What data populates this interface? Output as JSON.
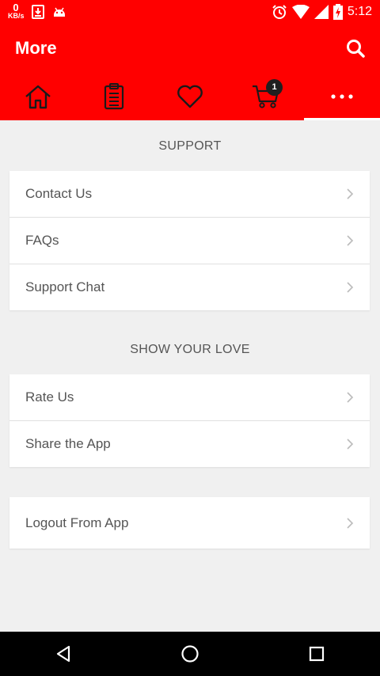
{
  "status_bar": {
    "speed_value": "0",
    "speed_unit": "KB/s",
    "time": "5:12",
    "icons": [
      "download-icon",
      "android-icon",
      "alarm-icon",
      "wifi-icon",
      "signal-icon",
      "battery-charging-icon"
    ]
  },
  "header": {
    "title": "More",
    "search_icon": "search-icon"
  },
  "tabs": [
    {
      "name": "home",
      "icon": "home-icon",
      "active": false
    },
    {
      "name": "orders",
      "icon": "clipboard-icon",
      "active": false
    },
    {
      "name": "wishlist",
      "icon": "heart-icon",
      "active": false
    },
    {
      "name": "cart",
      "icon": "cart-icon",
      "badge": "1",
      "active": false
    },
    {
      "name": "more",
      "icon": "more-dots-icon",
      "active": true
    }
  ],
  "sections": {
    "support": {
      "heading": "SUPPORT",
      "items": [
        "Contact Us",
        "FAQs",
        "Support Chat"
      ]
    },
    "show_love": {
      "heading": "SHOW YOUR LOVE",
      "items": [
        "Rate Us",
        "Share the App"
      ]
    },
    "account": {
      "items": [
        "Logout From App"
      ]
    }
  },
  "colors": {
    "brand_red": "#ff0000",
    "background": "#f0f0f0",
    "text_gray": "#555555",
    "divider": "#e0e0e0"
  },
  "nav_bar": {
    "icons": [
      "back-icon",
      "home-circle-icon",
      "recents-icon"
    ]
  }
}
